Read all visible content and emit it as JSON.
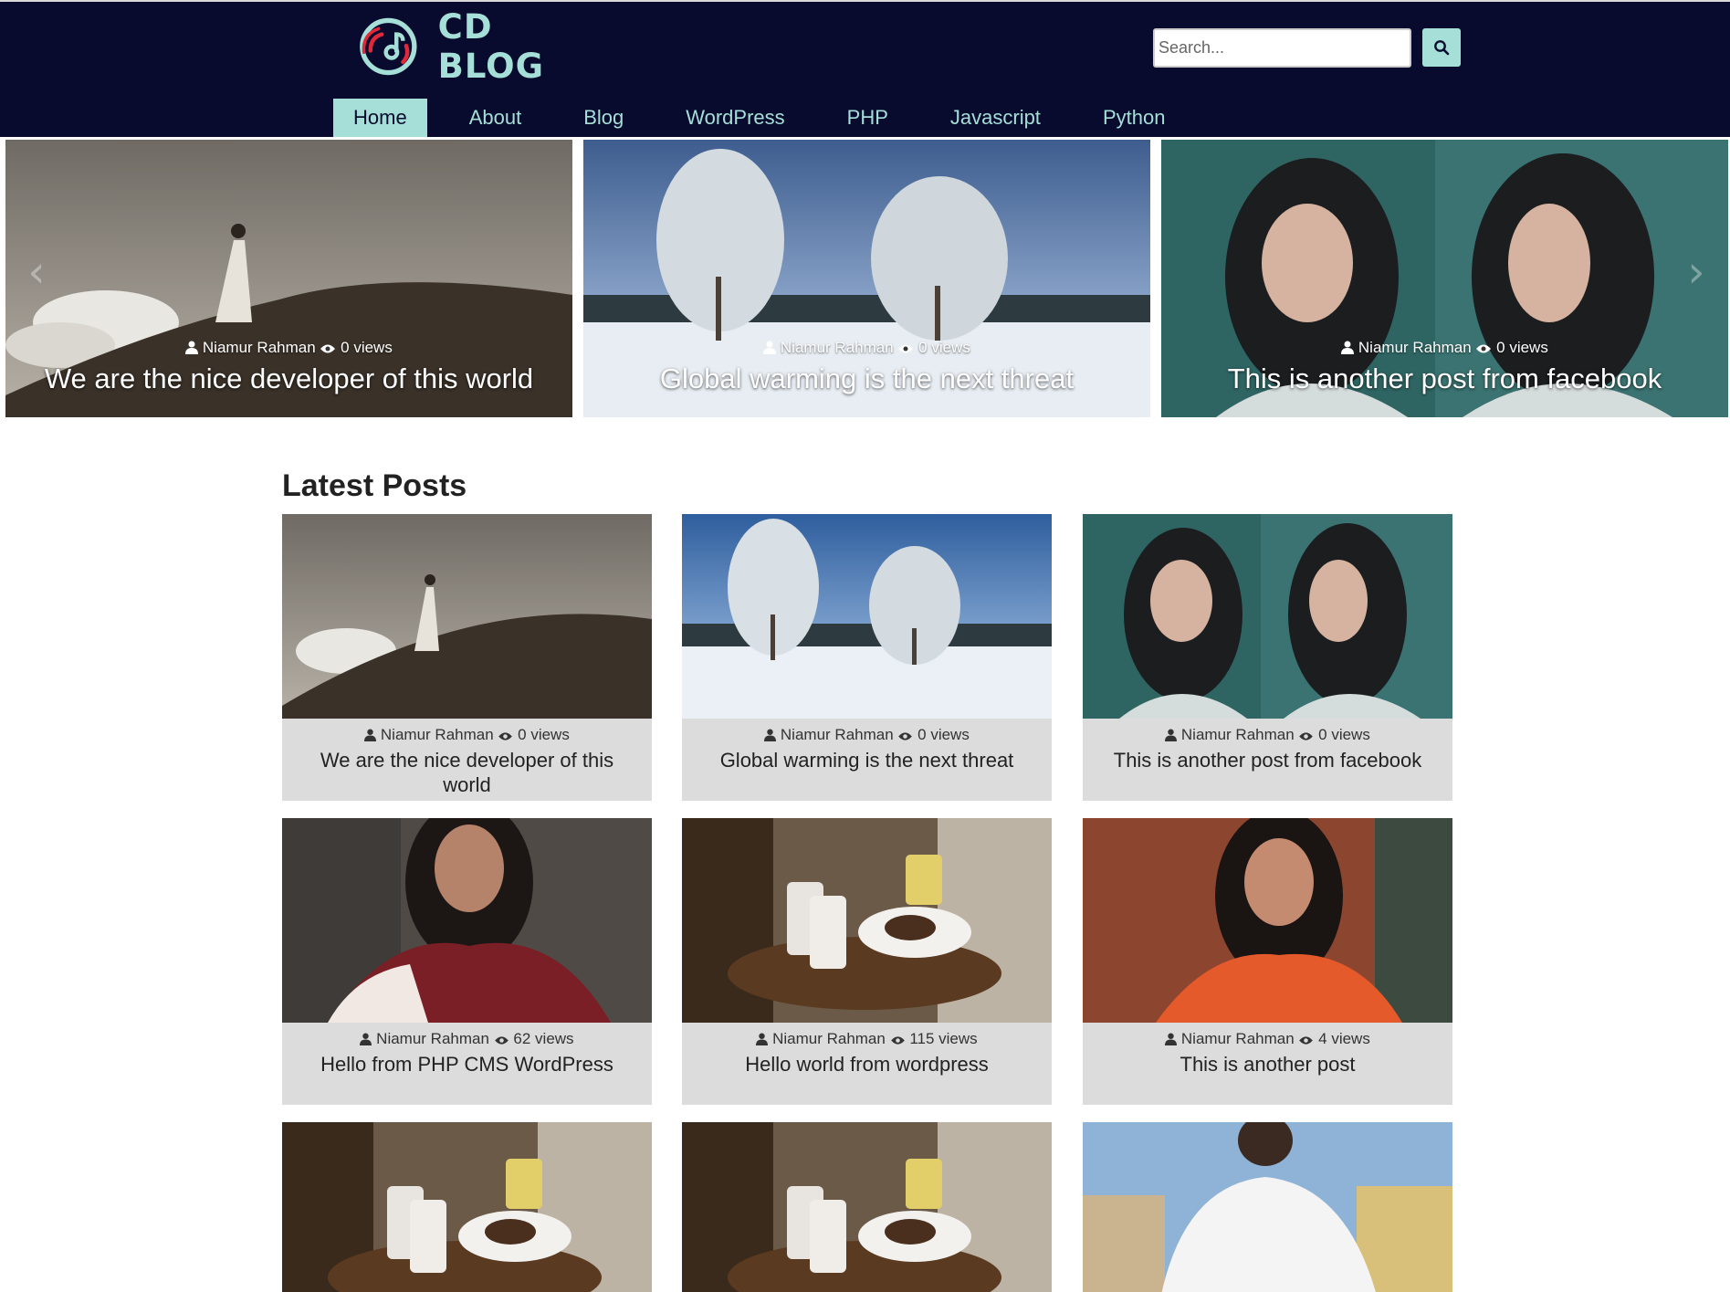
{
  "header": {
    "logo_text": "CD BLOG",
    "search": {
      "placeholder": "Search..."
    },
    "nav": [
      {
        "label": "Home",
        "active": true
      },
      {
        "label": "About"
      },
      {
        "label": "Blog"
      },
      {
        "label": "WordPress"
      },
      {
        "label": "PHP"
      },
      {
        "label": "Javascript"
      },
      {
        "label": "Python"
      }
    ]
  },
  "colors": {
    "header_bg": "#080b2d",
    "accent": "#a5dfd8",
    "card_bg": "#dcdcdc"
  },
  "slider": {
    "slides": [
      {
        "author": "Niamur Rahman",
        "views": "0 views",
        "title": "We are the nice developer of this world",
        "image": "woman-on-hill"
      },
      {
        "author": "Niamur Rahman",
        "views": "0 views",
        "title": "Global warming is the next threat",
        "image": "snowy-trees"
      },
      {
        "author": "Niamur Rahman",
        "views": "0 views",
        "title": "This is another post from facebook",
        "image": "two-portraits"
      }
    ],
    "prev_icon": "chevron-left-icon",
    "next_icon": "chevron-right-icon"
  },
  "latest": {
    "title": "Latest Posts",
    "posts": [
      {
        "author": "Niamur Rahman",
        "views": "0 views",
        "title": "We are the nice developer of this world",
        "image": "woman-on-hill"
      },
      {
        "author": "Niamur Rahman",
        "views": "0 views",
        "title": "Global warming is the next threat",
        "image": "snowy-trees"
      },
      {
        "author": "Niamur Rahman",
        "views": "0 views",
        "title": "This is another post from facebook",
        "image": "two-portraits"
      },
      {
        "author": "Niamur Rahman",
        "views": "62 views",
        "title": "Hello from PHP CMS WordPress",
        "image": "smiling-woman-red-scarf"
      },
      {
        "author": "Niamur Rahman",
        "views": "115 views",
        "title": "Hello world from wordpress",
        "image": "coffee-table"
      },
      {
        "author": "Niamur Rahman",
        "views": "4 views",
        "title": "This is another post",
        "image": "woman-brick-wall"
      },
      {
        "author": "",
        "views": "",
        "title": "",
        "image": "coffee-table"
      },
      {
        "author": "",
        "views": "",
        "title": "",
        "image": "coffee-table"
      },
      {
        "author": "",
        "views": "",
        "title": "",
        "image": "man-city"
      }
    ]
  }
}
